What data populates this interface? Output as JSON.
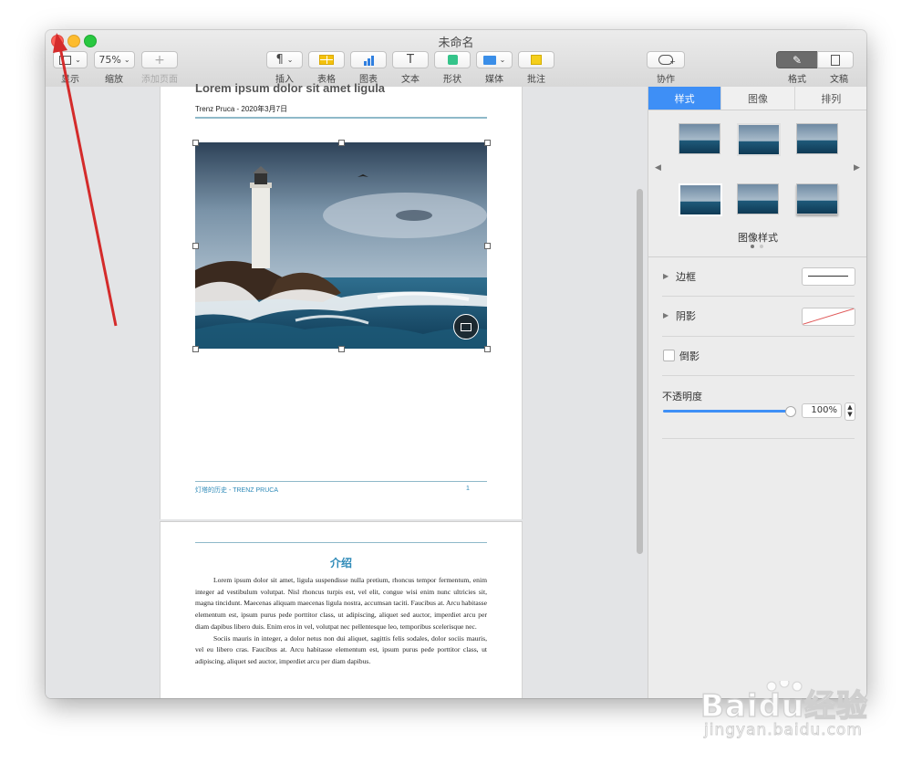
{
  "window": {
    "title": "未命名"
  },
  "toolbar": {
    "zoom_value": "75%",
    "view_label": "显示",
    "zoom_label": "缩放",
    "add_page_label": "添加页面",
    "insert_label": "插入",
    "table_label": "表格",
    "chart_label": "图表",
    "text_label": "文本",
    "shape_label": "形状",
    "media_label": "媒体",
    "comment_label": "批注",
    "collab_label": "协作",
    "format_label": "格式",
    "document_label": "文稿",
    "icons": [
      "sidebar-view-icon",
      "plus-icon",
      "pilcrow-icon",
      "table-icon",
      "chart-icon",
      "text-icon",
      "shape-icon",
      "media-icon",
      "comment-icon",
      "collaborate-icon",
      "format-brush-icon",
      "document-icon"
    ]
  },
  "page1": {
    "heading_partial": "Lorem ipsum dolor sit amet ligula",
    "byline": "Trenz Pruca - 2020年3月7日",
    "footer_left": "灯塔的历史 - TRENZ PRUCA",
    "footer_page": "1"
  },
  "page2": {
    "section_title": "介绍",
    "paragraph1": "Lorem ipsum dolor sit amet, ligula suspendisse nulla pretium, rhoncus tempor fermentum, enim integer ad vestibulum volutpat. Nisl rhoncus turpis est, vel elit, congue wisi enim nunc ultricies sit, magna tincidunt. Maecenas aliquam maecenas ligula nostra, accumsan taciti. Faucibus at. Arcu habitasse elementum est, ipsum purus pede porttitor class, ut adipiscing, aliquet sed auctor, imperdiet arcu per diam dapibus libero duis. Enim eros in vel, volutpat nec pellentesque leo, temporibus scelerisque nec.",
    "paragraph2": "Sociis mauris in integer, a dolor netus non dui aliquet, sagittis felis sodales, dolor sociis mauris, vel eu libero cras. Faucibus at. Arcu habitasse elementum est, ipsum purus pede porttitor class, ut adipiscing, aliquet sed auctor, imperdiet arcu per diam dapibus."
  },
  "inspector": {
    "tabs": [
      "样式",
      "图像",
      "排列"
    ],
    "active_tab": "样式",
    "styles_label": "图像样式",
    "border_label": "边框",
    "shadow_label": "阴影",
    "reflection_label": "倒影",
    "opacity_label": "不透明度",
    "opacity_value": "100%",
    "opacity_level": 1.0
  },
  "colors": {
    "accent": "#3e8ff6",
    "annotation_arrow": "#d42b2b",
    "page_rule": "#8fb9c9",
    "section_title": "#2e8ab8"
  },
  "watermark": {
    "brand": "Baidu经验",
    "url": "jingyan.baidu.com"
  }
}
